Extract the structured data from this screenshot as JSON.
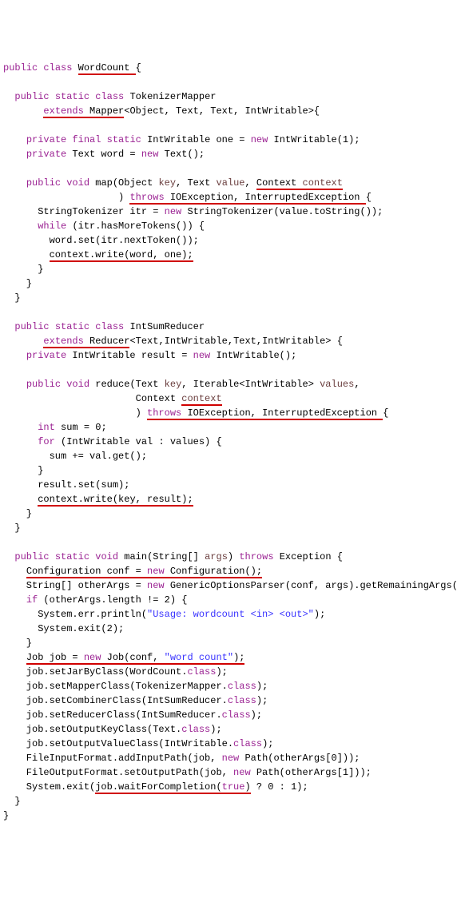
{
  "lines": [
    [
      {
        "t": "public ",
        "c": "k"
      },
      {
        "t": "class ",
        "c": "k"
      },
      {
        "t": "WordCount ",
        "c": "ul"
      },
      {
        "t": "{",
        "c": ""
      }
    ],
    [],
    [
      {
        "t": "  ",
        "c": ""
      },
      {
        "t": "public ",
        "c": "k"
      },
      {
        "t": "static ",
        "c": "k"
      },
      {
        "t": "class ",
        "c": "k"
      },
      {
        "t": "TokenizerMapper",
        "c": ""
      }
    ],
    [
      {
        "t": "       ",
        "c": ""
      },
      {
        "t": "extends ",
        "c": "k ul"
      },
      {
        "t": "Mapper",
        "c": "ul"
      },
      {
        "t": "<Object, Text, Text, IntWritable>{",
        "c": ""
      }
    ],
    [],
    [
      {
        "t": "    ",
        "c": ""
      },
      {
        "t": "private ",
        "c": "k"
      },
      {
        "t": "final ",
        "c": "k"
      },
      {
        "t": "static ",
        "c": "k"
      },
      {
        "t": "IntWritable one = ",
        "c": ""
      },
      {
        "t": "new ",
        "c": "k"
      },
      {
        "t": "IntWritable(1);",
        "c": ""
      }
    ],
    [
      {
        "t": "    ",
        "c": ""
      },
      {
        "t": "private ",
        "c": "k"
      },
      {
        "t": "Text word = ",
        "c": ""
      },
      {
        "t": "new ",
        "c": "k"
      },
      {
        "t": "Text();",
        "c": ""
      }
    ],
    [],
    [
      {
        "t": "    ",
        "c": ""
      },
      {
        "t": "public ",
        "c": "k"
      },
      {
        "t": "void ",
        "c": "k"
      },
      {
        "t": "map",
        "c": ""
      },
      {
        "t": "(Object ",
        "c": ""
      },
      {
        "t": "key",
        "c": "var"
      },
      {
        "t": ", Text ",
        "c": ""
      },
      {
        "t": "value",
        "c": "var"
      },
      {
        "t": ", ",
        "c": ""
      },
      {
        "t": "Context ",
        "c": "ul"
      },
      {
        "t": "context",
        "c": "var ul"
      }
    ],
    [
      {
        "t": "                    ) ",
        "c": ""
      },
      {
        "t": "throws ",
        "c": "k ul"
      },
      {
        "t": "IOException, InterruptedException ",
        "c": "ul"
      },
      {
        "t": "{",
        "c": ""
      }
    ],
    [
      {
        "t": "      StringTokenizer itr = ",
        "c": ""
      },
      {
        "t": "new ",
        "c": "k"
      },
      {
        "t": "StringTokenizer(value.toString());",
        "c": ""
      }
    ],
    [
      {
        "t": "      ",
        "c": ""
      },
      {
        "t": "while ",
        "c": "k"
      },
      {
        "t": "(itr.hasMoreTokens()) {",
        "c": ""
      }
    ],
    [
      {
        "t": "        word.set(itr.nextToken());",
        "c": ""
      }
    ],
    [
      {
        "t": "        ",
        "c": ""
      },
      {
        "t": "context.write(word, one);",
        "c": "ul"
      }
    ],
    [
      {
        "t": "      }",
        "c": ""
      }
    ],
    [
      {
        "t": "    }",
        "c": ""
      }
    ],
    [
      {
        "t": "  }",
        "c": ""
      }
    ],
    [],
    [
      {
        "t": "  ",
        "c": ""
      },
      {
        "t": "public ",
        "c": "k"
      },
      {
        "t": "static ",
        "c": "k"
      },
      {
        "t": "class ",
        "c": "k"
      },
      {
        "t": "IntSumReducer",
        "c": ""
      }
    ],
    [
      {
        "t": "       ",
        "c": ""
      },
      {
        "t": "extends ",
        "c": "k ul"
      },
      {
        "t": "Reducer",
        "c": "ul"
      },
      {
        "t": "<Text,IntWritable,Text,IntWritable> {",
        "c": ""
      }
    ],
    [
      {
        "t": "    ",
        "c": ""
      },
      {
        "t": "private ",
        "c": "k"
      },
      {
        "t": "IntWritable result = ",
        "c": ""
      },
      {
        "t": "new ",
        "c": "k"
      },
      {
        "t": "IntWritable();",
        "c": ""
      }
    ],
    [],
    [
      {
        "t": "    ",
        "c": ""
      },
      {
        "t": "public ",
        "c": "k"
      },
      {
        "t": "void ",
        "c": "k"
      },
      {
        "t": "reduce(Text ",
        "c": ""
      },
      {
        "t": "key",
        "c": "var"
      },
      {
        "t": ", Iterable<IntWritable> ",
        "c": ""
      },
      {
        "t": "values",
        "c": "var"
      },
      {
        "t": ",",
        "c": ""
      }
    ],
    [
      {
        "t": "                       Context ",
        "c": ""
      },
      {
        "t": "context",
        "c": "var ul"
      }
    ],
    [
      {
        "t": "                       ) ",
        "c": ""
      },
      {
        "t": "throws ",
        "c": "k ul"
      },
      {
        "t": "IOException, InterruptedException ",
        "c": "ul"
      },
      {
        "t": "{",
        "c": ""
      }
    ],
    [
      {
        "t": "      ",
        "c": ""
      },
      {
        "t": "int ",
        "c": "k"
      },
      {
        "t": "sum = 0;",
        "c": ""
      }
    ],
    [
      {
        "t": "      ",
        "c": ""
      },
      {
        "t": "for ",
        "c": "k"
      },
      {
        "t": "(IntWritable val : values) {",
        "c": ""
      }
    ],
    [
      {
        "t": "        sum += val.get();",
        "c": ""
      }
    ],
    [
      {
        "t": "      }",
        "c": ""
      }
    ],
    [
      {
        "t": "      result.set(sum);",
        "c": ""
      }
    ],
    [
      {
        "t": "      ",
        "c": ""
      },
      {
        "t": "context.write(key, result);",
        "c": "ul"
      }
    ],
    [
      {
        "t": "    }",
        "c": ""
      }
    ],
    [
      {
        "t": "  }",
        "c": ""
      }
    ],
    [],
    [
      {
        "t": "  ",
        "c": ""
      },
      {
        "t": "public ",
        "c": "k"
      },
      {
        "t": "static ",
        "c": "k"
      },
      {
        "t": "void ",
        "c": "k"
      },
      {
        "t": "main(String[] ",
        "c": ""
      },
      {
        "t": "args",
        "c": "var"
      },
      {
        "t": ") ",
        "c": ""
      },
      {
        "t": "throws ",
        "c": "k"
      },
      {
        "t": "Exception {",
        "c": ""
      }
    ],
    [
      {
        "t": "    ",
        "c": ""
      },
      {
        "t": "Configuration conf = ",
        "c": "ul"
      },
      {
        "t": "new ",
        "c": "k ul"
      },
      {
        "t": "Configuration();",
        "c": "ul"
      }
    ],
    [
      {
        "t": "    String[] otherArgs = ",
        "c": ""
      },
      {
        "t": "new ",
        "c": "k"
      },
      {
        "t": "GenericOptionsParser(conf, args).getRemainingArgs();",
        "c": ""
      }
    ],
    [
      {
        "t": "    ",
        "c": ""
      },
      {
        "t": "if ",
        "c": "k"
      },
      {
        "t": "(otherArgs.length != 2) {",
        "c": ""
      }
    ],
    [
      {
        "t": "      System.err.println(",
        "c": ""
      },
      {
        "t": "\"Usage: wordcount <in> <out>\"",
        "c": "string"
      },
      {
        "t": ");",
        "c": ""
      }
    ],
    [
      {
        "t": "      System.exit(2);",
        "c": ""
      }
    ],
    [
      {
        "t": "    }",
        "c": ""
      }
    ],
    [
      {
        "t": "    ",
        "c": ""
      },
      {
        "t": "Job job = ",
        "c": "ul"
      },
      {
        "t": "new ",
        "c": "k ul"
      },
      {
        "t": "Job(conf, ",
        "c": "ul"
      },
      {
        "t": "\"word count\"",
        "c": "string ul"
      },
      {
        "t": ");",
        "c": "ul"
      }
    ],
    [
      {
        "t": "    job.setJarByClass(WordCount.",
        "c": ""
      },
      {
        "t": "class",
        "c": "k"
      },
      {
        "t": ");",
        "c": ""
      }
    ],
    [
      {
        "t": "    job.setMapperClass(TokenizerMapper.",
        "c": ""
      },
      {
        "t": "class",
        "c": "k"
      },
      {
        "t": ");",
        "c": ""
      }
    ],
    [
      {
        "t": "    job.setCombinerClass(IntSumReducer.",
        "c": ""
      },
      {
        "t": "class",
        "c": "k"
      },
      {
        "t": ");",
        "c": ""
      }
    ],
    [
      {
        "t": "    job.setReducerClass(IntSumReducer.",
        "c": ""
      },
      {
        "t": "class",
        "c": "k"
      },
      {
        "t": ");",
        "c": ""
      }
    ],
    [
      {
        "t": "    job.setOutputKeyClass(Text.",
        "c": ""
      },
      {
        "t": "class",
        "c": "k"
      },
      {
        "t": ");",
        "c": ""
      }
    ],
    [
      {
        "t": "    job.setOutputValueClass(IntWritable.",
        "c": ""
      },
      {
        "t": "class",
        "c": "k"
      },
      {
        "t": ");",
        "c": ""
      }
    ],
    [
      {
        "t": "    FileInputFormat.addInputPath(job, ",
        "c": ""
      },
      {
        "t": "new ",
        "c": "k"
      },
      {
        "t": "Path(otherArgs[0]));",
        "c": ""
      }
    ],
    [
      {
        "t": "    FileOutputFormat.setOutputPath(job, ",
        "c": ""
      },
      {
        "t": "new ",
        "c": "k"
      },
      {
        "t": "Path(otherArgs[1]));",
        "c": ""
      }
    ],
    [
      {
        "t": "    System.exit(",
        "c": ""
      },
      {
        "t": "job.waitForCompletion(",
        "c": "ul"
      },
      {
        "t": "true",
        "c": "k ul"
      },
      {
        "t": ")",
        "c": "ul"
      },
      {
        "t": " ? 0 : 1);",
        "c": ""
      }
    ],
    [
      {
        "t": "  }",
        "c": ""
      }
    ],
    [
      {
        "t": "}",
        "c": ""
      }
    ]
  ]
}
